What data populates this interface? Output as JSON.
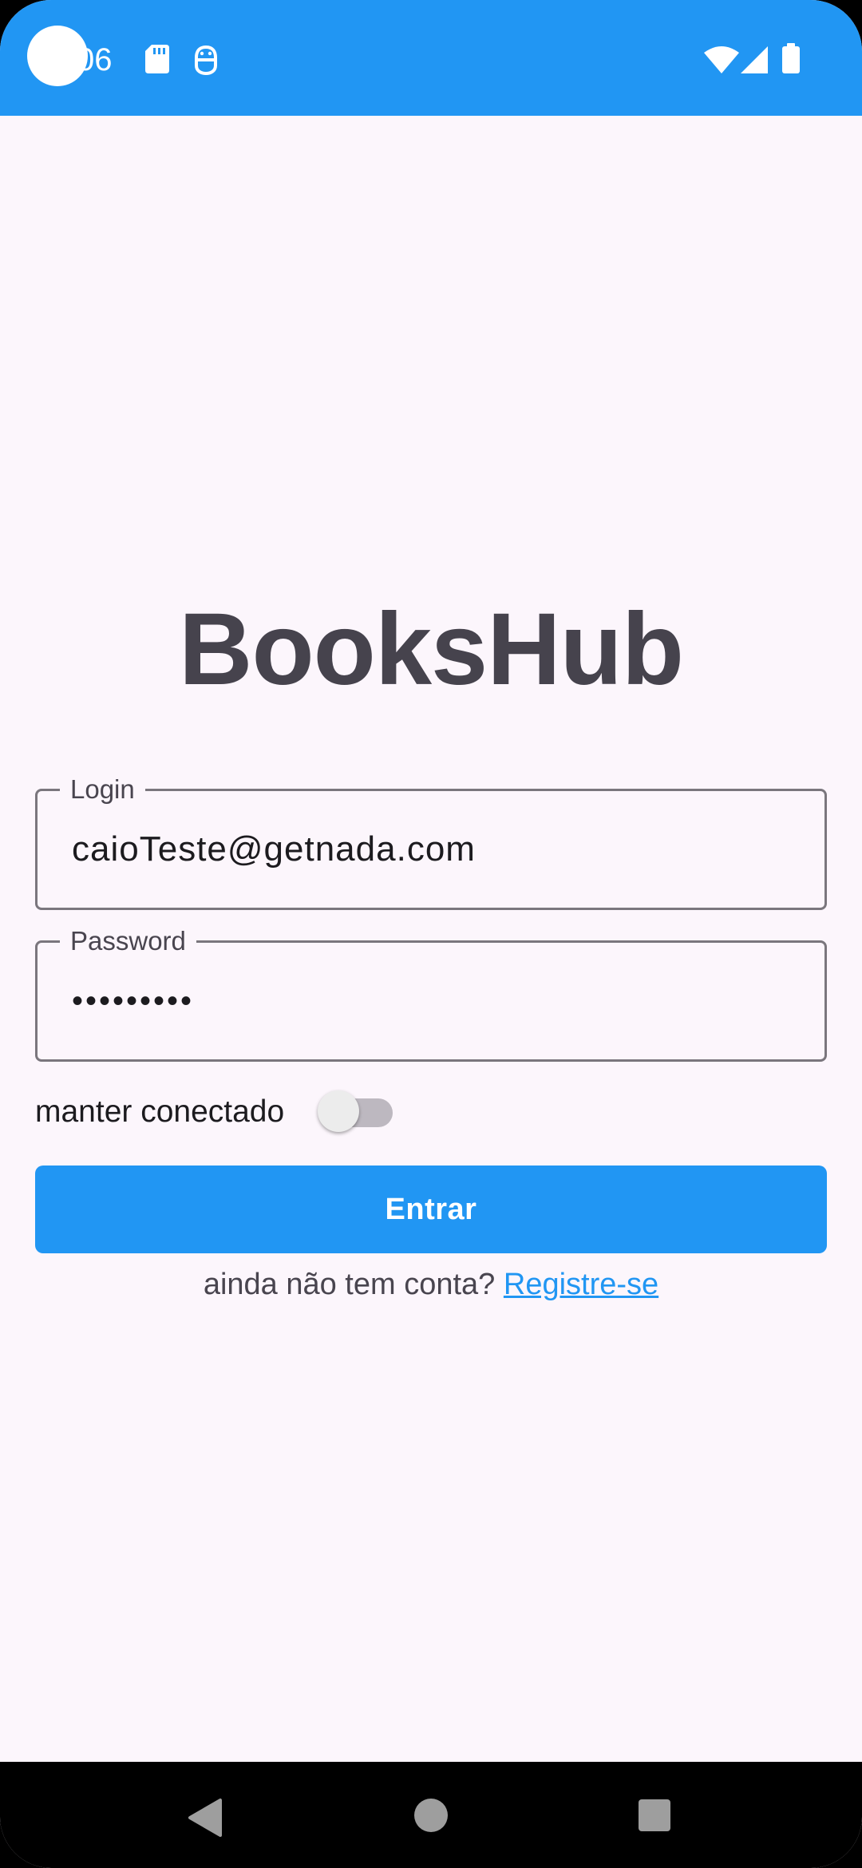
{
  "status_bar": {
    "time": "06",
    "background_color": "#2196f3",
    "left_icons": [
      "sd-card-icon",
      "debug-icon"
    ],
    "right_icons": [
      "wifi-icon",
      "cell-signal-icon",
      "battery-icon"
    ]
  },
  "app": {
    "title": "BooksHub",
    "login_field": {
      "label": "Login",
      "value": "caioTeste@getnada.com"
    },
    "password_field": {
      "label": "Password",
      "value": "•••••••••"
    },
    "keep_connected": {
      "label": "manter conectado",
      "on": false
    },
    "submit_button": {
      "label": "Entrar",
      "color": "#2196f3"
    },
    "register": {
      "prompt": "ainda não tem conta?",
      "link": "Registre-se"
    }
  },
  "nav_bar": {
    "icons": [
      "back-icon",
      "home-icon",
      "recents-icon"
    ]
  }
}
